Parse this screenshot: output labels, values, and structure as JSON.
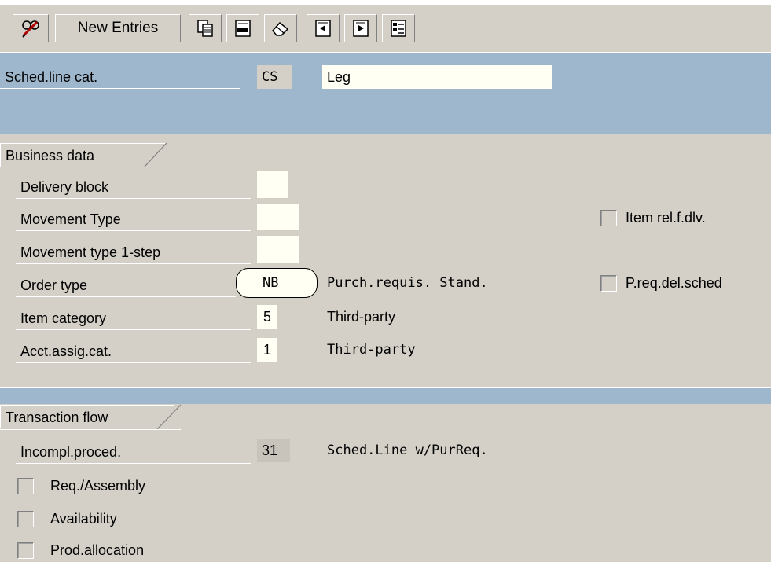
{
  "toolbar": {
    "new_entries_label": "New Entries"
  },
  "header": {
    "sched_line_cat_label": "Sched.line cat.",
    "sched_line_cat_value": "CS",
    "sched_line_cat_desc": "Leg"
  },
  "business_data": {
    "section_title": "Business data",
    "delivery_block_label": "Delivery block",
    "delivery_block_value": "",
    "movement_type_label": "Movement Type",
    "movement_type_value": "",
    "movement_type_1step_label": "Movement type 1-step",
    "movement_type_1step_value": "",
    "order_type_label": "Order type",
    "order_type_value": "NB",
    "order_type_desc": "Purch.requis. Stand.",
    "item_category_label": "Item category",
    "item_category_value": "5",
    "item_category_desc": "Third-party",
    "acct_assig_cat_label": "Acct.assig.cat.",
    "acct_assig_cat_value": "1",
    "acct_assig_cat_desc": "Third-party",
    "item_rel_dlv_label": "Item rel.f.dlv.",
    "item_rel_dlv_checked": false,
    "preq_del_sched_label": "P.req.del.sched",
    "preq_del_sched_checked": false
  },
  "transaction_flow": {
    "section_title": "Transaction flow",
    "incompl_proced_label": "Incompl.proced.",
    "incompl_proced_value": "31",
    "incompl_proced_desc": "Sched.Line w/PurReq.",
    "req_assembly_label": "Req./Assembly",
    "availability_label": "Availability",
    "prod_allocation_label": "Prod.allocation"
  }
}
